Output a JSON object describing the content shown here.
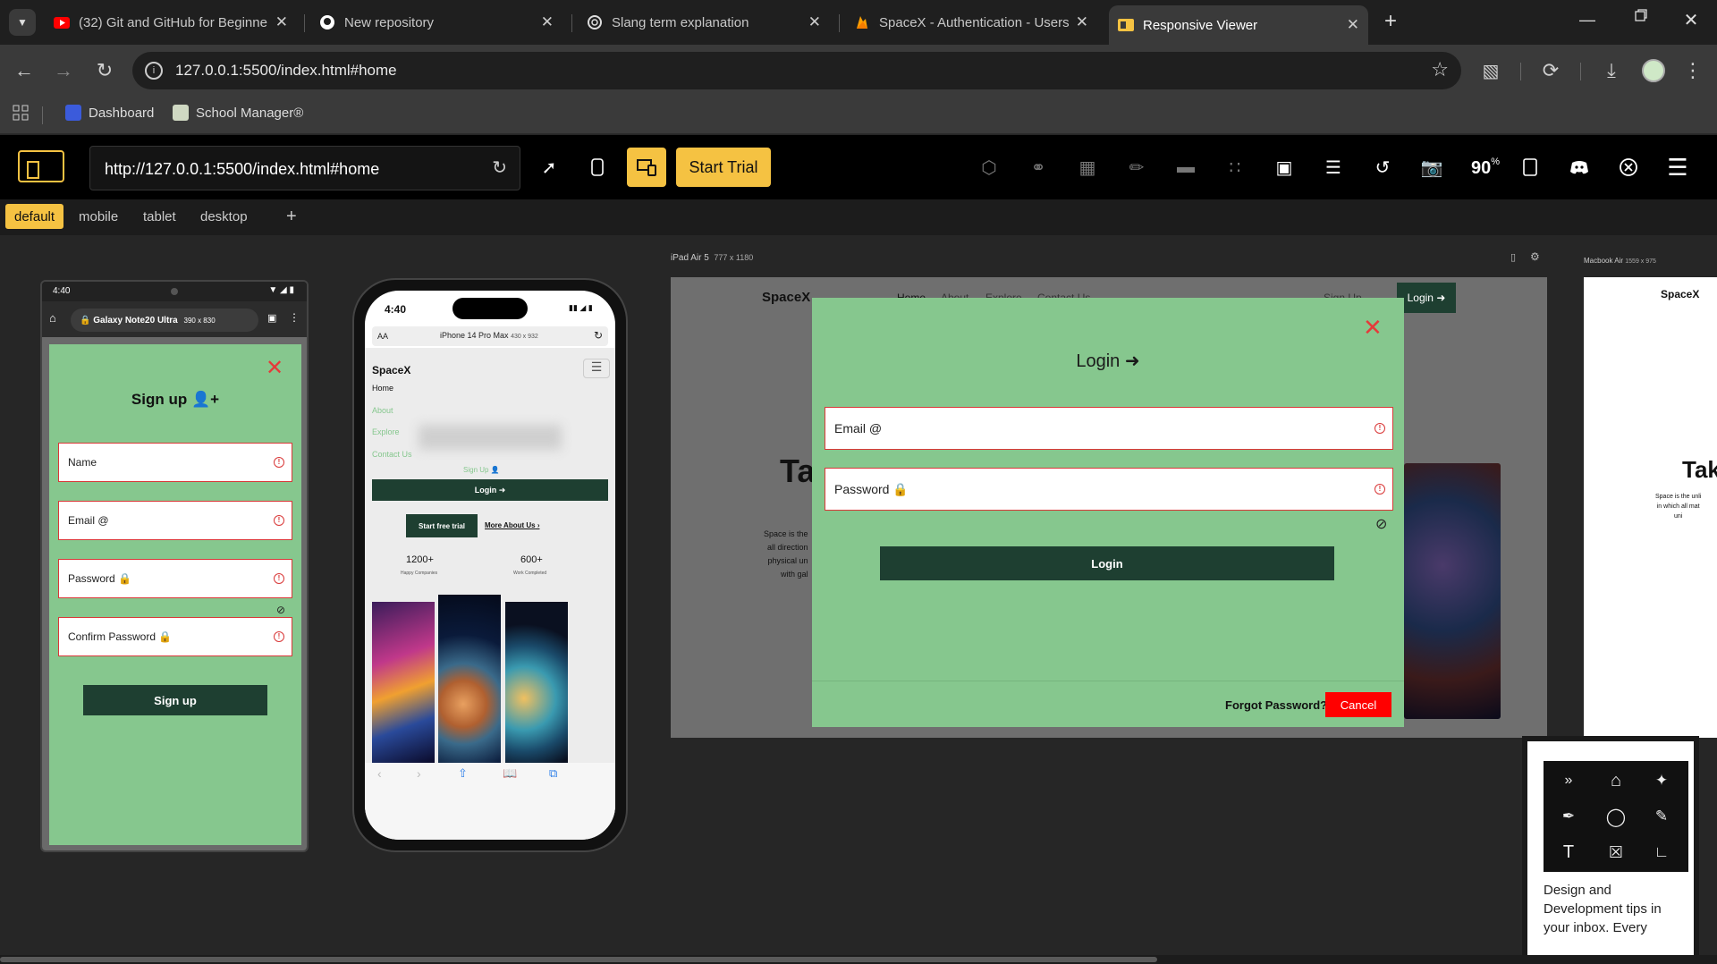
{
  "browser": {
    "tabs": [
      {
        "title": "(32) Git and GitHub for Beginne",
        "icon": "youtube-icon"
      },
      {
        "title": "New repository",
        "icon": "github-icon"
      },
      {
        "title": "Slang term explanation",
        "icon": "openai-icon"
      },
      {
        "title": "SpaceX - Authentication - Users",
        "icon": "firebase-icon"
      },
      {
        "title": "Responsive Viewer",
        "icon": "responsive-viewer-icon"
      }
    ],
    "new_tab": "+",
    "address": "127.0.0.1:5500/index.html#home",
    "bookmarks": [
      {
        "label": "Dashboard"
      },
      {
        "label": "School Manager®"
      }
    ]
  },
  "viewer": {
    "url": "http://127.0.0.1:5500/index.html#home",
    "start_trial": "Start Trial",
    "zoom": "90",
    "zoom_unit": "%",
    "presets": [
      "default",
      "mobile",
      "tablet",
      "desktop"
    ],
    "add_preset": "+"
  },
  "devices": {
    "galaxy": {
      "name": "Galaxy Note20 Ultra",
      "size": "390 x 830",
      "time": "4:40",
      "form": {
        "title": "Sign up",
        "fields": [
          "Name",
          "Email",
          "Password",
          "Confirm Password"
        ],
        "submit": "Sign up"
      }
    },
    "iphone": {
      "time": "4:40",
      "aa": "AA",
      "name": "iPhone 14 Pro Max",
      "size": "430 x 932",
      "brand": "SpaceX",
      "menu": [
        "Home",
        "About",
        "Explore",
        "Contact Us"
      ],
      "signup_link": "Sign Up",
      "login": "Login",
      "start_free_trial": "Start free trial",
      "more_about": "More About Us",
      "stats": [
        {
          "value": "1200+",
          "label": "Happy Companies"
        },
        {
          "value": "600+",
          "label": "Work Completed"
        }
      ]
    },
    "ipad": {
      "name": "iPad Air 5",
      "size": "777 x 1180",
      "brand": "SpaceX",
      "nav": [
        "Home",
        "About",
        "Explore",
        "Contact Us"
      ],
      "signup": "Sign Up",
      "login_nav": "Login",
      "hero_heading": "Ta",
      "hero_text": [
        "Space is the",
        "all direction",
        "physical un",
        "with gal"
      ],
      "modal": {
        "title": "Login",
        "email": "Email",
        "password": "Password",
        "submit": "Login",
        "forgot": "Forgot Password?",
        "cancel": "Cancel"
      }
    },
    "macbook": {
      "name": "Macbook Air",
      "size": "1559 x 975",
      "brand": "SpaceX",
      "hero_heading": "Tak",
      "hero_text": [
        "Space is the unli",
        "in which all mat",
        "uni"
      ]
    }
  },
  "widget": {
    "text": "Design and Development tips in your inbox. Every"
  },
  "colors": {
    "accent": "#f5c242",
    "form_green": "#86c78e",
    "dark_green": "#1e3f31",
    "error_red": "#d93838",
    "cancel_red": "#ff0000"
  }
}
